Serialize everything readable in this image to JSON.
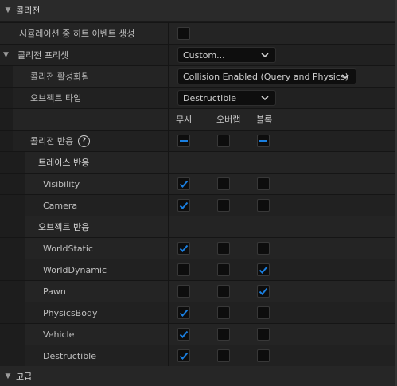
{
  "sections": {
    "collision_title": "콜리전",
    "advanced_title": "고급"
  },
  "properties": {
    "sim_hit_label": "시뮬레이션 중 히트 이벤트 생성",
    "preset_label": "콜리전 프리셋",
    "preset_value": "Custom...",
    "enabled_label": "콜리전 활성화됨",
    "enabled_value": "Collision Enabled (Query and Physics)",
    "object_type_label": "오브젝트 타입",
    "object_type_value": "Destructible"
  },
  "columns": [
    "무시",
    "오버랩",
    "블록"
  ],
  "collision_response": {
    "label": "콜리전 반응",
    "help": "?",
    "state": [
      "partial",
      "none",
      "partial"
    ]
  },
  "trace_header": "트레이스 반응",
  "traces": [
    {
      "name": "Visibility",
      "state": "ignore"
    },
    {
      "name": "Camera",
      "state": "ignore"
    }
  ],
  "object_header": "오브젝트 반응",
  "objects": [
    {
      "name": "WorldStatic",
      "state": "ignore"
    },
    {
      "name": "WorldDynamic",
      "state": "block"
    },
    {
      "name": "Pawn",
      "state": "block"
    },
    {
      "name": "PhysicsBody",
      "state": "ignore"
    },
    {
      "name": "Vehicle",
      "state": "ignore"
    },
    {
      "name": "Destructible",
      "state": "ignore"
    }
  ],
  "colors": {
    "accent": "#1a7fe0",
    "background": "#242424",
    "header": "#2a2a2a"
  }
}
